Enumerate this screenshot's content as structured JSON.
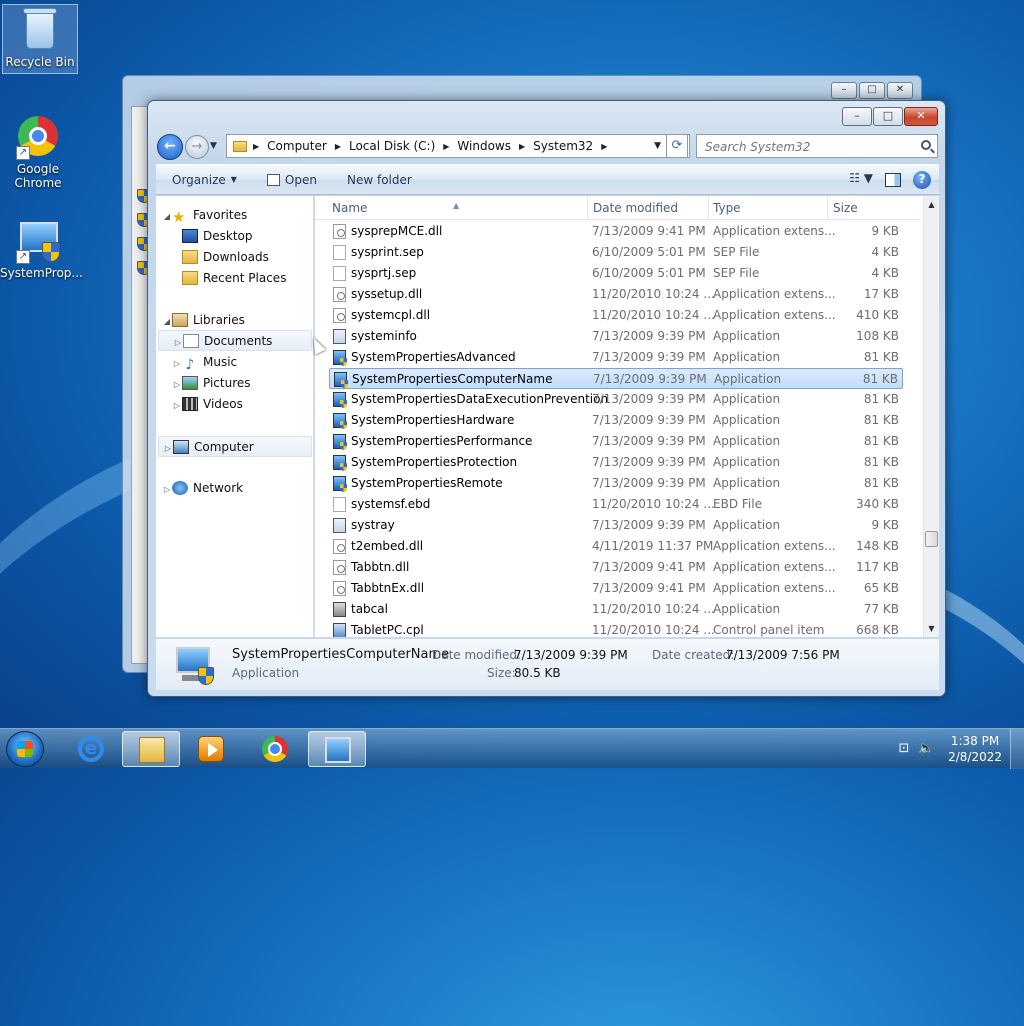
{
  "desktop": {
    "icons": [
      {
        "label": "Recycle Bin",
        "icon": "recycle-bin-icon"
      },
      {
        "label": "Google Chrome",
        "icon": "chrome-icon"
      },
      {
        "label": "SystemProp...",
        "icon": "system-properties-icon"
      }
    ]
  },
  "window": {
    "controls": {
      "minimize": "–",
      "maximize": "□",
      "close": "✕"
    },
    "breadcrumb": [
      "Computer",
      "Local Disk (C:)",
      "Windows",
      "System32"
    ],
    "search_placeholder": "Search System32",
    "toolbar": {
      "organize": "Organize",
      "open": "Open",
      "new_folder": "New folder"
    }
  },
  "navpane": {
    "favorites": {
      "label": "Favorites",
      "items": [
        "Desktop",
        "Downloads",
        "Recent Places"
      ]
    },
    "libraries": {
      "label": "Libraries",
      "items": [
        "Documents",
        "Music",
        "Pictures",
        "Videos"
      ]
    },
    "computer": "Computer",
    "network": "Network"
  },
  "filelist": {
    "columns": {
      "name": "Name",
      "date": "Date modified",
      "type": "Type",
      "size": "Size"
    },
    "selected": "SystemPropertiesComputerName",
    "rows": [
      {
        "name": "sysprepMCE.dll",
        "date": "7/13/2009 9:41 PM",
        "type": "Application extens...",
        "size": "9 KB",
        "icon": "dll"
      },
      {
        "name": "sysprint.sep",
        "date": "6/10/2009 5:01 PM",
        "type": "SEP File",
        "size": "4 KB",
        "icon": "doc"
      },
      {
        "name": "sysprtj.sep",
        "date": "6/10/2009 5:01 PM",
        "type": "SEP File",
        "size": "4 KB",
        "icon": "doc"
      },
      {
        "name": "syssetup.dll",
        "date": "11/20/2010 10:24 ...",
        "type": "Application extens...",
        "size": "17 KB",
        "icon": "dll"
      },
      {
        "name": "systemcpl.dll",
        "date": "11/20/2010 10:24 ...",
        "type": "Application extens...",
        "size": "410 KB",
        "icon": "dll"
      },
      {
        "name": "systeminfo",
        "date": "7/13/2009 9:39 PM",
        "type": "Application",
        "size": "108 KB",
        "icon": "app"
      },
      {
        "name": "SystemPropertiesAdvanced",
        "date": "7/13/2009 9:39 PM",
        "type": "Application",
        "size": "81 KB",
        "icon": "sysprop"
      },
      {
        "name": "SystemPropertiesComputerName",
        "date": "7/13/2009 9:39 PM",
        "type": "Application",
        "size": "81 KB",
        "icon": "sysprop"
      },
      {
        "name": "SystemPropertiesDataExecutionPrevention",
        "date": "7/13/2009 9:39 PM",
        "type": "Application",
        "size": "81 KB",
        "icon": "sysprop"
      },
      {
        "name": "SystemPropertiesHardware",
        "date": "7/13/2009 9:39 PM",
        "type": "Application",
        "size": "81 KB",
        "icon": "sysprop"
      },
      {
        "name": "SystemPropertiesPerformance",
        "date": "7/13/2009 9:39 PM",
        "type": "Application",
        "size": "81 KB",
        "icon": "sysprop"
      },
      {
        "name": "SystemPropertiesProtection",
        "date": "7/13/2009 9:39 PM",
        "type": "Application",
        "size": "81 KB",
        "icon": "sysprop"
      },
      {
        "name": "SystemPropertiesRemote",
        "date": "7/13/2009 9:39 PM",
        "type": "Application",
        "size": "81 KB",
        "icon": "sysprop"
      },
      {
        "name": "systemsf.ebd",
        "date": "11/20/2010 10:24 ...",
        "type": "EBD File",
        "size": "340 KB",
        "icon": "doc"
      },
      {
        "name": "systray",
        "date": "7/13/2009 9:39 PM",
        "type": "Application",
        "size": "9 KB",
        "icon": "app"
      },
      {
        "name": "t2embed.dll",
        "date": "4/11/2019 11:37 PM",
        "type": "Application extens...",
        "size": "148 KB",
        "icon": "dll"
      },
      {
        "name": "Tabbtn.dll",
        "date": "7/13/2009 9:41 PM",
        "type": "Application extens...",
        "size": "117 KB",
        "icon": "dll"
      },
      {
        "name": "TabbtnEx.dll",
        "date": "7/13/2009 9:41 PM",
        "type": "Application extens...",
        "size": "65 KB",
        "icon": "dll"
      },
      {
        "name": "tabcal",
        "date": "11/20/2010 10:24 ...",
        "type": "Application",
        "size": "77 KB",
        "icon": "tab"
      },
      {
        "name": "TabletPC.cpl",
        "date": "11/20/2010 10:24 ...",
        "type": "Control panel item",
        "size": "668 KB",
        "icon": "cpl"
      }
    ]
  },
  "details": {
    "name": "SystemPropertiesComputerName",
    "type": "Application",
    "date_modified_label": "Date modified:",
    "date_modified": "7/13/2009 9:39 PM",
    "date_created_label": "Date created:",
    "date_created": "7/13/2009 7:56 PM",
    "size_label": "Size:",
    "size": "80.5 KB"
  },
  "taskbar": {
    "apps": [
      "internet-explorer-icon",
      "windows-explorer-icon",
      "media-player-icon",
      "chrome-icon",
      "system-properties-icon"
    ],
    "clock_time": "1:38 PM",
    "clock_date": "2/8/2022"
  }
}
